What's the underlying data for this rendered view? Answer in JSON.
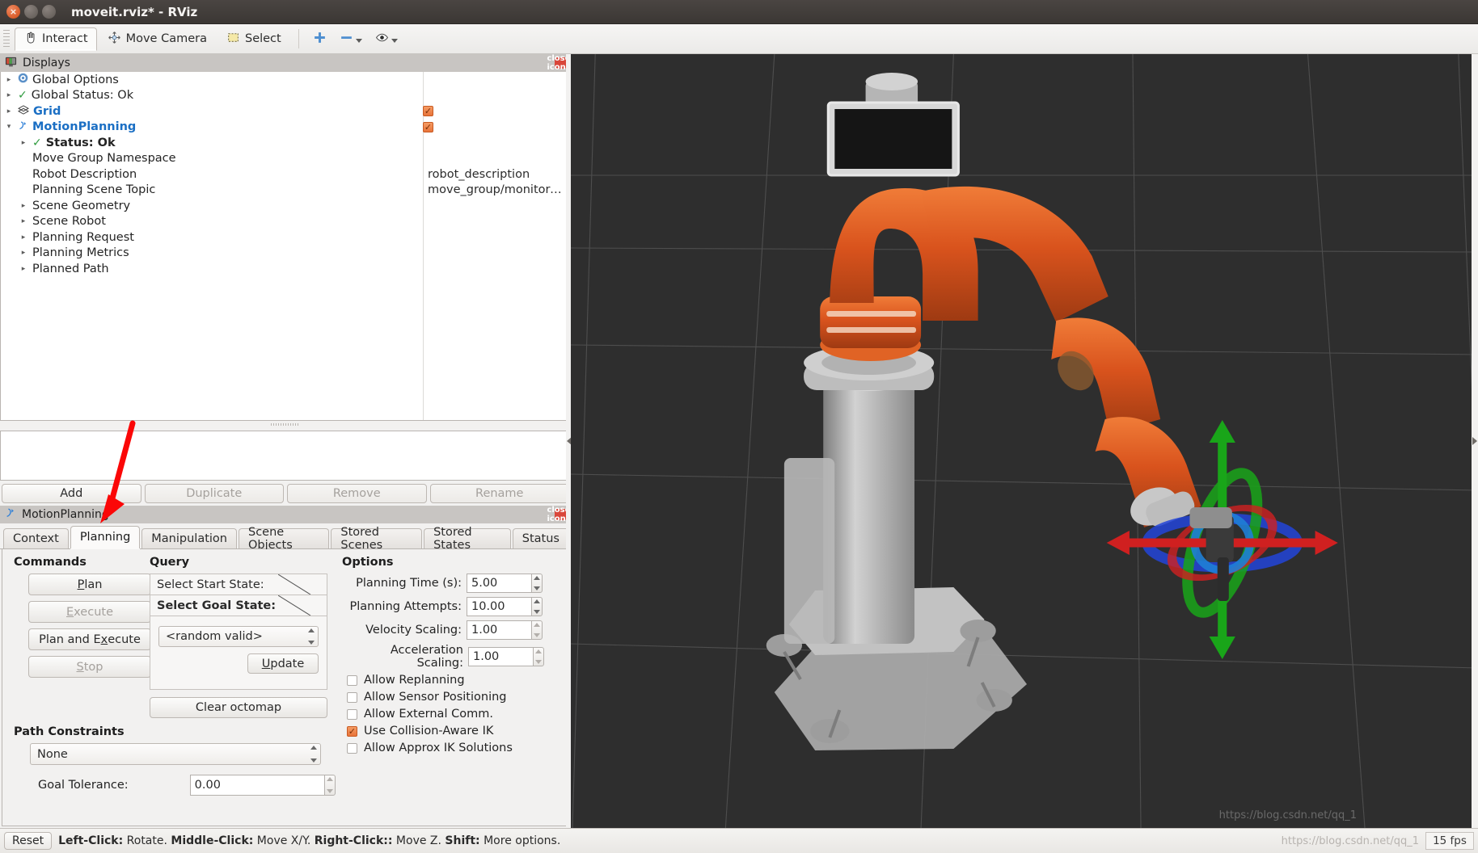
{
  "window": {
    "title": "moveit.rviz* - RViz",
    "controls": {
      "close": "×",
      "minimize": "–",
      "maximize": "□"
    }
  },
  "toolbar": {
    "items": [
      {
        "label": "Interact",
        "icon": "hand-cursor-icon",
        "active": true
      },
      {
        "label": "Move Camera",
        "icon": "move-camera-icon",
        "active": false
      },
      {
        "label": "Select",
        "icon": "select-rect-icon",
        "active": false
      }
    ],
    "add_icon": "plus-icon",
    "remove_icon": "minus-icon",
    "focus_icon": "eye-icon"
  },
  "displays": {
    "title": "Displays",
    "title_icon": "displays-monitor-icon",
    "close_icon": "close-icon",
    "rows": [
      {
        "indent": 0,
        "arrow": "▸",
        "icon": "gear-icon",
        "name": "Global Options",
        "style": "plain",
        "value": "",
        "check": null
      },
      {
        "indent": 0,
        "arrow": "▸",
        "icon": "ok-check-icon",
        "name": "Global Status: Ok",
        "style": "plain",
        "value": "",
        "check": null
      },
      {
        "indent": 0,
        "arrow": "▸",
        "icon": "grid-icon",
        "name": "Grid",
        "style": "link",
        "value": "",
        "check": true
      },
      {
        "indent": 0,
        "arrow": "▾",
        "icon": "motion-planning-icon",
        "name": "MotionPlanning",
        "style": "link",
        "value": "",
        "check": true
      },
      {
        "indent": 1,
        "arrow": "▸",
        "icon": "ok-check-icon",
        "name": "Status: Ok",
        "style": "bold",
        "value": "",
        "check": null
      },
      {
        "indent": 1,
        "arrow": "",
        "icon": "",
        "name": "Move Group Namespace",
        "style": "plain",
        "value": "",
        "check": null
      },
      {
        "indent": 1,
        "arrow": "",
        "icon": "",
        "name": "Robot Description",
        "style": "plain",
        "value": "robot_description",
        "check": null
      },
      {
        "indent": 1,
        "arrow": "",
        "icon": "",
        "name": "Planning Scene Topic",
        "style": "plain",
        "value": "move_group/monitore…",
        "check": null
      },
      {
        "indent": 1,
        "arrow": "▸",
        "icon": "",
        "name": "Scene Geometry",
        "style": "plain",
        "value": "",
        "check": null
      },
      {
        "indent": 1,
        "arrow": "▸",
        "icon": "",
        "name": "Scene Robot",
        "style": "plain",
        "value": "",
        "check": null
      },
      {
        "indent": 1,
        "arrow": "▸",
        "icon": "",
        "name": "Planning Request",
        "style": "plain",
        "value": "",
        "check": null
      },
      {
        "indent": 1,
        "arrow": "▸",
        "icon": "",
        "name": "Planning Metrics",
        "style": "plain",
        "value": "",
        "check": null
      },
      {
        "indent": 1,
        "arrow": "▸",
        "icon": "",
        "name": "Planned Path",
        "style": "plain",
        "value": "",
        "check": null
      }
    ],
    "buttons": [
      {
        "label": "Add",
        "enabled": true
      },
      {
        "label": "Duplicate",
        "enabled": false
      },
      {
        "label": "Remove",
        "enabled": false
      },
      {
        "label": "Rename",
        "enabled": false
      }
    ]
  },
  "motion_planning": {
    "title": "MotionPlanning",
    "title_icon": "motion-planning-icon",
    "close_icon": "close-icon",
    "tabs": [
      {
        "label": "Context",
        "selected": false
      },
      {
        "label": "Planning",
        "selected": true
      },
      {
        "label": "Manipulation",
        "selected": false
      },
      {
        "label": "Scene Objects",
        "selected": false
      },
      {
        "label": "Stored Scenes",
        "selected": false
      },
      {
        "label": "Stored States",
        "selected": false
      },
      {
        "label": "Status",
        "selected": false
      }
    ],
    "commands": {
      "heading": "Commands",
      "buttons": [
        {
          "label": "Plan",
          "mnemonic": "P",
          "enabled": true
        },
        {
          "label": "Execute",
          "mnemonic": "E",
          "enabled": false
        },
        {
          "label": "Plan and Execute",
          "mnemonic": "x",
          "enabled": true
        },
        {
          "label": "Stop",
          "mnemonic": "S",
          "enabled": false
        }
      ]
    },
    "query": {
      "heading": "Query",
      "start_state_label": "Select Start State:",
      "goal_state_label": "Select Goal State:",
      "goal_state_value": "<random valid>",
      "update_button": "Update",
      "clear_octomap_button": "Clear octomap"
    },
    "options": {
      "heading": "Options",
      "fields": [
        {
          "label": "Planning Time (s):",
          "value": "5.00",
          "enabled": true
        },
        {
          "label": "Planning Attempts:",
          "value": "10.00",
          "enabled": true
        },
        {
          "label": "Velocity Scaling:",
          "value": "1.00",
          "enabled": false
        },
        {
          "label": "Acceleration Scaling:",
          "value": "1.00",
          "enabled": false
        }
      ],
      "checkboxes": [
        {
          "label": "Allow Replanning",
          "checked": false
        },
        {
          "label": "Allow Sensor Positioning",
          "checked": false
        },
        {
          "label": "Allow External Comm.",
          "checked": false
        },
        {
          "label": "Use Collision-Aware IK",
          "checked": true
        },
        {
          "label": "Allow Approx IK Solutions",
          "checked": false
        }
      ]
    },
    "path_constraints": {
      "heading": "Path Constraints",
      "value": "None",
      "goal_tolerance_label": "Goal Tolerance:",
      "goal_tolerance_value": "0.00"
    }
  },
  "view3d": {
    "fps_overlay": "",
    "watermark": "https://blog.csdn.net/qq_1"
  },
  "statusbar": {
    "reset_button": "Reset",
    "hint_parts": [
      {
        "text": "Left-Click:",
        "bold": true
      },
      {
        "text": " Rotate. ",
        "bold": false
      },
      {
        "text": "Middle-Click:",
        "bold": true
      },
      {
        "text": " Move X/Y. ",
        "bold": false
      },
      {
        "text": "Right-Click::",
        "bold": true
      },
      {
        "text": " Move Z. ",
        "bold": false
      },
      {
        "text": "Shift:",
        "bold": true
      },
      {
        "text": " More options.",
        "bold": false
      }
    ],
    "watermark": "https://blog.csdn.net/qq_1",
    "fps": "15 fps"
  },
  "colors": {
    "accent_orange": "#e8743a",
    "link_blue": "#1b6fc4",
    "ok_green": "#2e9b3e",
    "annotation_red": "#fb0707",
    "viewport_bg": "#2e2e2e",
    "robot_orange": "#d9531d",
    "robot_grey": "#b8b8b8"
  }
}
